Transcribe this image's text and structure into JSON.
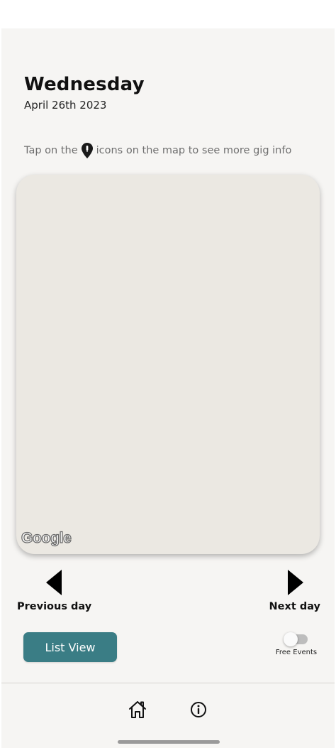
{
  "header": {
    "day": "Wednesday",
    "date": "April 26th 2023"
  },
  "hint": {
    "prefix": "Tap on the",
    "icon": "map-pin-icon",
    "suffix": "icons on the map to see more gig info"
  },
  "map": {
    "attribution": "Google",
    "background_color": "#ebe8e2"
  },
  "navigation": {
    "previous_label": "Previous day",
    "next_label": "Next day"
  },
  "actions": {
    "list_view_label": "List View",
    "free_events_label": "Free Events",
    "free_events_on": false
  },
  "bottom_nav": {
    "items": [
      {
        "icon": "home-icon"
      },
      {
        "icon": "info-icon"
      }
    ]
  },
  "colors": {
    "accent": "#3a7d85",
    "background": "#f6f5f3"
  }
}
